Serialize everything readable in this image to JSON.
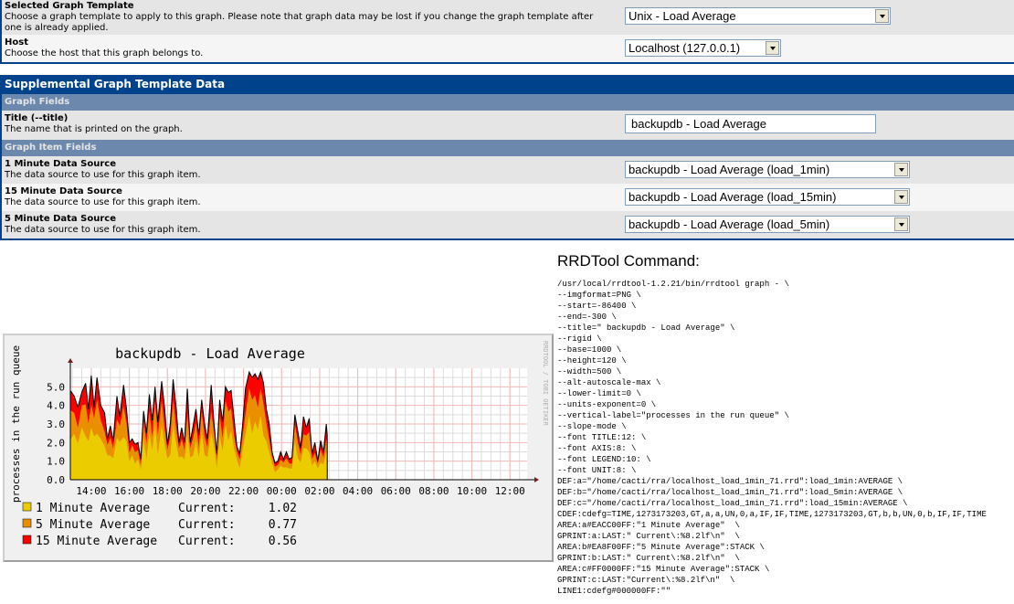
{
  "top_rows": [
    {
      "label": "Selected Graph Template",
      "description": "Choose a graph template to apply to this graph. Please note that graph data may be lost if you change the graph template after one is already applied.",
      "value": "Unix - Load Average"
    },
    {
      "label": "Host",
      "description": "Choose the host that this graph belongs to.",
      "value": "Localhost (127.0.0.1)"
    }
  ],
  "supplemental": {
    "title": "Supplemental Graph Template Data",
    "graph_fields_header": "Graph Fields",
    "title_field": {
      "label": "Title (--title)",
      "description": "The name that is printed on the graph.",
      "value": "backupdb - Load Average"
    },
    "graph_item_fields_header": "Graph Item Fields",
    "items": [
      {
        "label": "1 Minute Data Source",
        "description": "The data source to use for this graph item.",
        "value": "backupdb - Load Average (load_1min)"
      },
      {
        "label": "15 Minute Data Source",
        "description": "The data source to use for this graph item.",
        "value": "backupdb - Load Average (load_15min)"
      },
      {
        "label": "5 Minute Data Source",
        "description": "The data source to use for this graph item.",
        "value": "backupdb - Load Average (load_5min)"
      }
    ]
  },
  "rrdtool": {
    "heading": "RRDTool Command:",
    "command_lines": [
      "/usr/local/rrdtool-1.2.21/bin/rrdtool graph - \\",
      "--imgformat=PNG \\",
      "--start=-86400 \\",
      "--end=-300 \\",
      "--title=\" backupdb - Load Average\" \\",
      "--rigid \\",
      "--base=1000 \\",
      "--height=120 \\",
      "--width=500 \\",
      "--alt-autoscale-max \\",
      "--lower-limit=0 \\",
      "--units-exponent=0 \\",
      "--vertical-label=\"processes in the run queue\" \\",
      "--slope-mode \\",
      "--font TITLE:12: \\",
      "--font AXIS:8: \\",
      "--font LEGEND:10: \\",
      "--font UNIT:8: \\",
      "DEF:a=\"/home/cacti/rra/localhost_load_1min_71.rrd\":load_1min:AVERAGE \\",
      "DEF:b=\"/home/cacti/rra/localhost_load_1min_71.rrd\":load_5min:AVERAGE \\",
      "DEF:c=\"/home/cacti/rra/localhost_load_1min_71.rrd\":load_15min:AVERAGE \\",
      "CDEF:cdefg=TIME,1273173203,GT,a,a,UN,0,a,IF,IF,TIME,1273173203,GT,b,b,UN,0,b,IF,IF,TIME",
      "AREA:a#EACC00FF:\"1 Minute Average\"  \\",
      "GPRINT:a:LAST:\" Current\\:%8.2lf\\n\"  \\",
      "AREA:b#EA8F00FF:\"5 Minute Average\":STACK \\",
      "GPRINT:b:LAST:\" Current\\:%8.2lf\\n\"  \\",
      "AREA:c#FF0000FF:\"15 Minute Average\":STACK \\",
      "GPRINT:c:LAST:\"Current\\:%8.2lf\\n\"  \\",
      "LINE1:cdefg#000000FF:\"\""
    ]
  },
  "chart_data": {
    "type": "area",
    "title": "backupdb - Load Average",
    "ylabel": "processes in the run queue",
    "xlabel": "",
    "watermark": "RRDTOOL / TOBI OETIKER",
    "ylim": [
      0,
      6.0
    ],
    "yticks": [
      "0.0",
      "1.0",
      "2.0",
      "3.0",
      "4.0",
      "5.0"
    ],
    "xticks": [
      "14:00",
      "16:00",
      "18:00",
      "20:00",
      "22:00",
      "00:00",
      "02:00",
      "04:00",
      "06:00",
      "08:00",
      "10:00",
      "12:00"
    ],
    "x_start_hour": 12.9,
    "x_end_hour": 36.9,
    "data_end_hour": 26.4,
    "grid": true,
    "stacked": true,
    "series": [
      {
        "name": "1 Minute Average",
        "color": "#EACC00",
        "current_label": "Current:",
        "current": "1.02"
      },
      {
        "name": "5 Minute Average",
        "color": "#EA8F00",
        "current_label": "Current:",
        "current": "0.77"
      },
      {
        "name": "15 Minute Average",
        "color": "#FF0000",
        "current_label": "Current:",
        "current": "0.56"
      }
    ],
    "total_profile": [
      [
        12.9,
        4.8
      ],
      [
        13.1,
        4.5
      ],
      [
        13.3,
        3.9
      ],
      [
        13.5,
        4.7
      ],
      [
        13.7,
        5.2
      ],
      [
        13.85,
        3.8
      ],
      [
        14.0,
        5.6
      ],
      [
        14.15,
        3.9
      ],
      [
        14.3,
        5.5
      ],
      [
        14.5,
        4.0
      ],
      [
        14.7,
        3.6
      ],
      [
        14.85,
        2.2
      ],
      [
        15.0,
        2.9
      ],
      [
        15.15,
        2.1
      ],
      [
        15.35,
        4.5
      ],
      [
        15.5,
        3.4
      ],
      [
        15.7,
        5.1
      ],
      [
        15.85,
        3.8
      ],
      [
        16.0,
        2.0
      ],
      [
        16.15,
        2.2
      ],
      [
        16.3,
        1.9
      ],
      [
        16.45,
        2.0
      ],
      [
        16.6,
        1.1
      ],
      [
        16.75,
        3.7
      ],
      [
        16.9,
        2.5
      ],
      [
        17.05,
        4.6
      ],
      [
        17.2,
        3.2
      ],
      [
        17.35,
        5.0
      ],
      [
        17.5,
        3.1
      ],
      [
        17.7,
        5.3
      ],
      [
        17.85,
        3.9
      ],
      [
        18.0,
        1.9
      ],
      [
        18.15,
        3.0
      ],
      [
        18.3,
        5.4
      ],
      [
        18.45,
        4.0
      ],
      [
        18.6,
        2.0
      ],
      [
        18.75,
        2.8
      ],
      [
        18.9,
        2.0
      ],
      [
        19.05,
        4.9
      ],
      [
        19.2,
        2.0
      ],
      [
        19.35,
        2.9
      ],
      [
        19.5,
        3.8
      ],
      [
        19.65,
        2.4
      ],
      [
        19.8,
        4.3
      ],
      [
        19.95,
        3.0
      ],
      [
        20.1,
        2.2
      ],
      [
        20.3,
        5.1
      ],
      [
        20.45,
        3.0
      ],
      [
        20.6,
        1.4
      ],
      [
        20.75,
        4.3
      ],
      [
        20.9,
        3.1
      ],
      [
        21.05,
        5.0
      ],
      [
        21.2,
        4.7
      ],
      [
        21.35,
        4.8
      ],
      [
        21.5,
        3.3
      ],
      [
        21.65,
        1.8
      ],
      [
        21.8,
        1.4
      ],
      [
        21.95,
        2.9
      ],
      [
        22.1,
        4.9
      ],
      [
        22.3,
        5.8
      ],
      [
        22.45,
        5.5
      ],
      [
        22.6,
        5.7
      ],
      [
        22.75,
        5.4
      ],
      [
        22.9,
        5.8
      ],
      [
        23.05,
        5.2
      ],
      [
        23.2,
        3.8
      ],
      [
        23.35,
        3.0
      ],
      [
        23.5,
        1.5
      ],
      [
        23.65,
        0.9
      ],
      [
        23.8,
        1.0
      ],
      [
        23.95,
        1.5
      ],
      [
        24.1,
        1.1
      ],
      [
        24.25,
        1.5
      ],
      [
        24.4,
        1.1
      ],
      [
        24.55,
        1.2
      ],
      [
        24.7,
        3.5
      ],
      [
        24.85,
        2.6
      ],
      [
        25.0,
        1.7
      ],
      [
        25.15,
        3.4
      ],
      [
        25.3,
        2.8
      ],
      [
        25.45,
        3.3
      ],
      [
        25.6,
        1.4
      ],
      [
        25.75,
        2.0
      ],
      [
        25.9,
        1.0
      ],
      [
        26.05,
        2.1
      ],
      [
        26.2,
        1.5
      ],
      [
        26.35,
        3.0
      ],
      [
        26.4,
        2.4
      ]
    ]
  }
}
